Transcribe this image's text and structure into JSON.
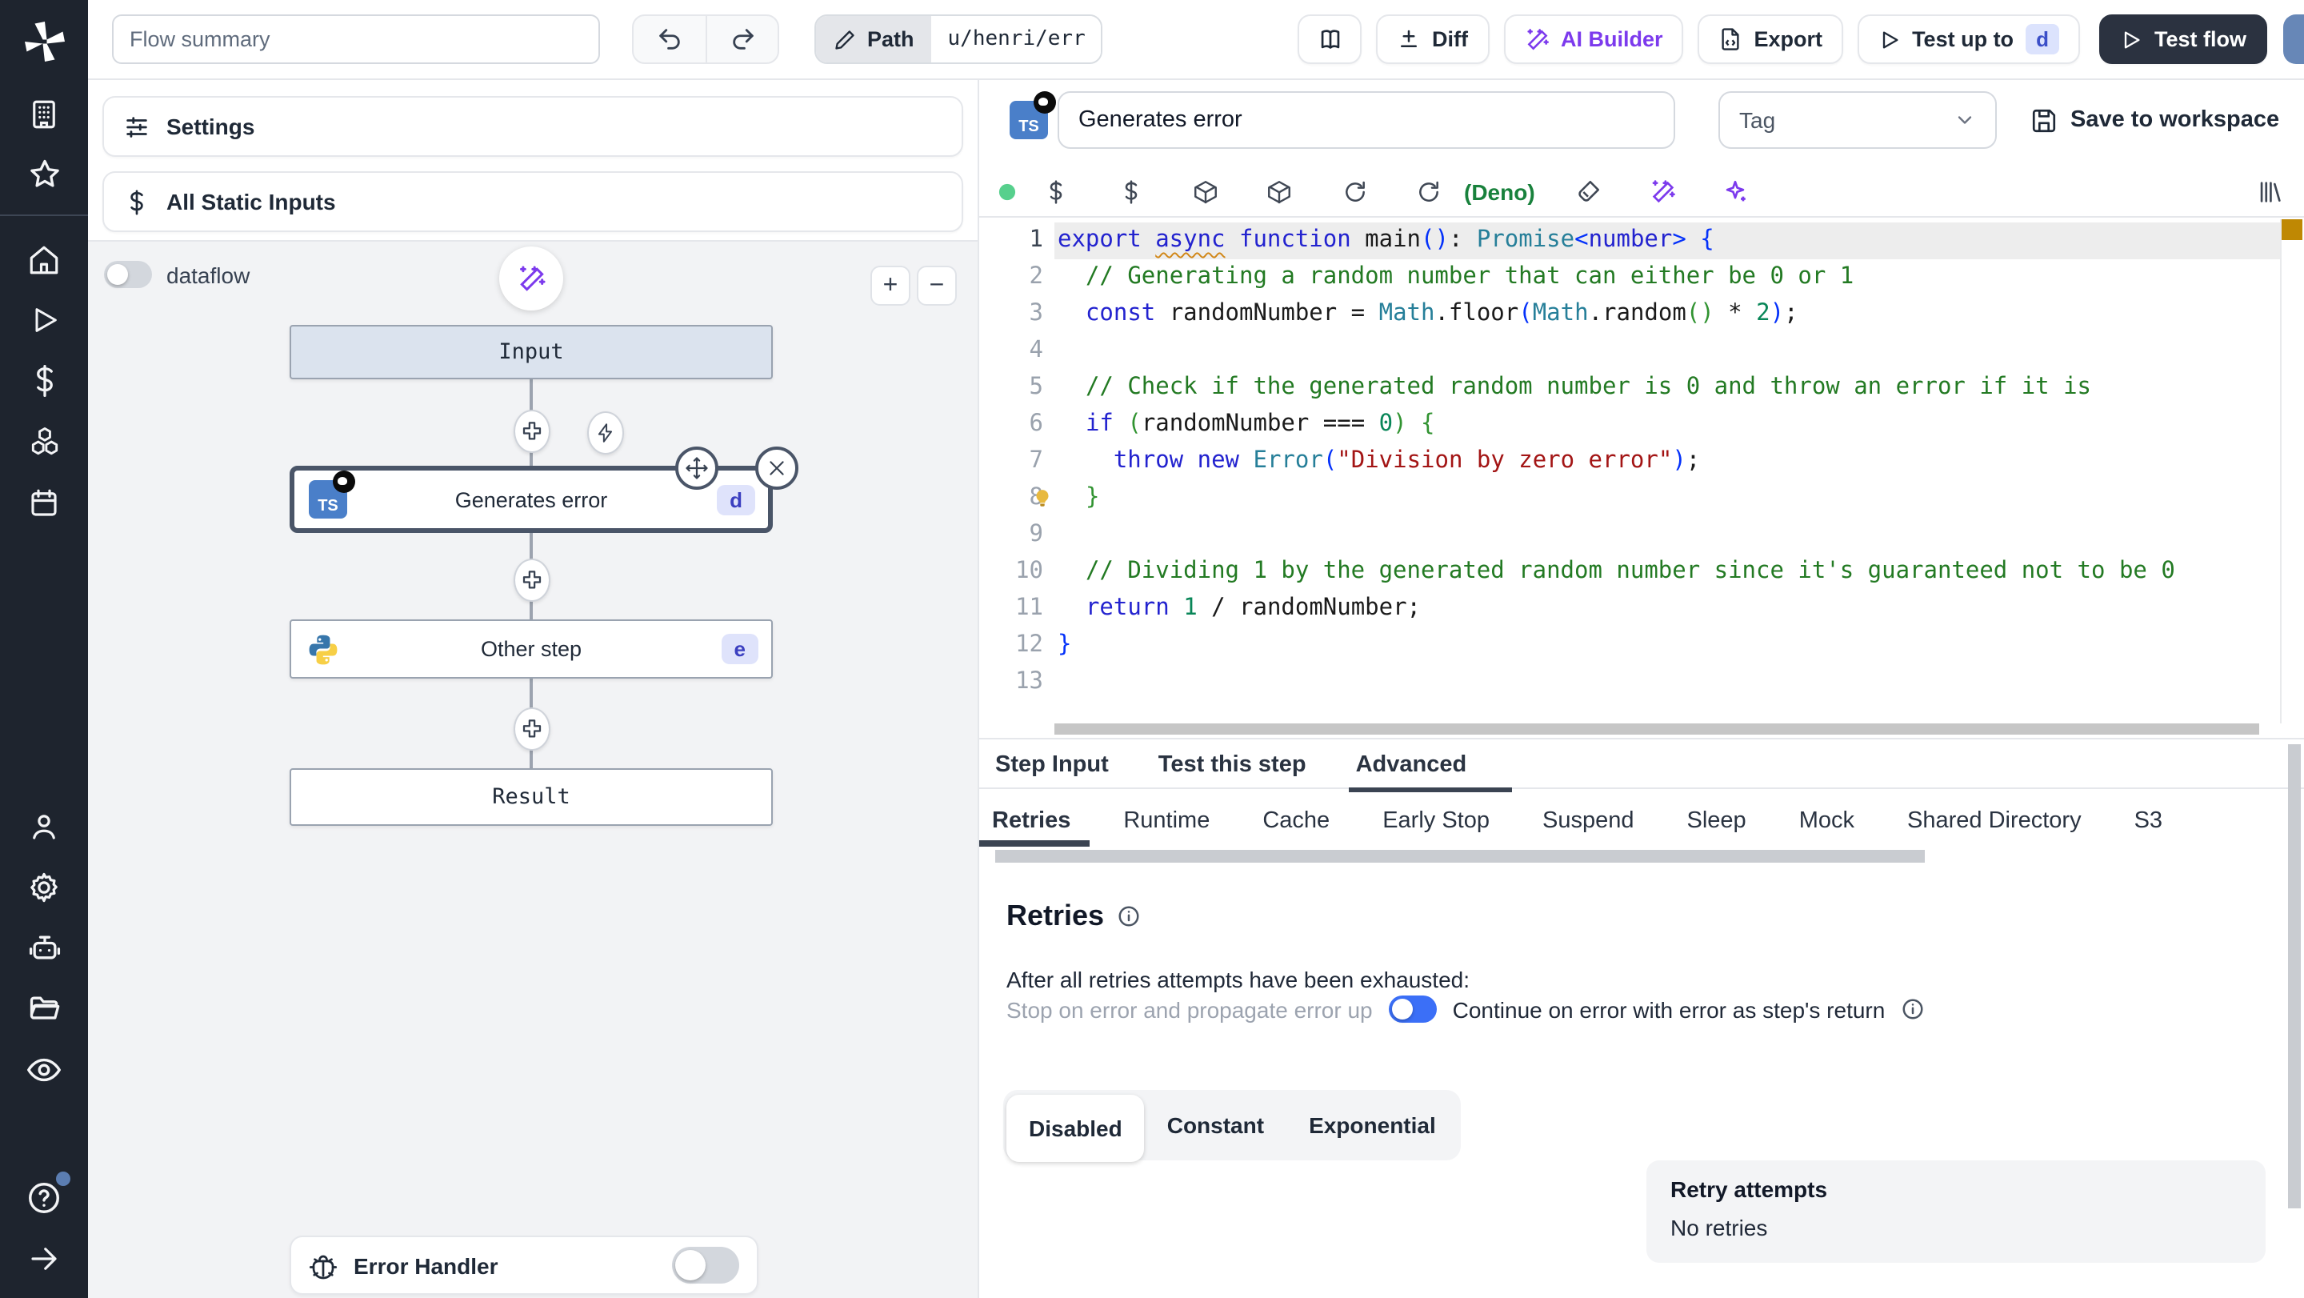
{
  "topbar": {
    "flow_summary_placeholder": "Flow summary",
    "path_label": "Path",
    "path_value": "u/henri/err",
    "diff_label": "Diff",
    "ai_builder_label": "AI Builder",
    "export_label": "Export",
    "test_up_to_label": "Test up to",
    "test_up_to_badge": "d",
    "test_flow_label": "Test flow"
  },
  "left_panel": {
    "settings_label": "Settings",
    "static_inputs_label": "All Static Inputs",
    "dataflow_label": "dataflow",
    "error_handler_label": "Error Handler",
    "nodes": {
      "input": "Input",
      "generates_error": "Generates error",
      "generates_error_badge": "d",
      "other_step": "Other step",
      "other_step_badge": "e",
      "result": "Result"
    }
  },
  "step": {
    "name": "Generates error",
    "tag_placeholder": "Tag",
    "save_label": "Save to workspace",
    "lang_note": "(Deno)"
  },
  "code": {
    "language": "typescript",
    "lines": [
      {
        "n": 1,
        "tokens": [
          {
            "t": "export ",
            "c": "kw"
          },
          {
            "t": "async",
            "c": "kw sq"
          },
          {
            "t": " ",
            "c": "pl"
          },
          {
            "t": "function",
            "c": "kw"
          },
          {
            "t": " main",
            "c": "pl"
          },
          {
            "t": "()",
            "c": "brb"
          },
          {
            "t": ": ",
            "c": "pl"
          },
          {
            "t": "Promise",
            "c": "ty"
          },
          {
            "t": "<",
            "c": "brb"
          },
          {
            "t": "number",
            "c": "kw"
          },
          {
            "t": ">",
            "c": "brb"
          },
          {
            "t": " ",
            "c": "pl"
          },
          {
            "t": "{",
            "c": "brb"
          }
        ]
      },
      {
        "n": 2,
        "tokens": [
          {
            "t": "  ",
            "c": "pl"
          },
          {
            "t": "// Generating a random number that can either be 0 or 1",
            "c": "cm"
          }
        ]
      },
      {
        "n": 3,
        "tokens": [
          {
            "t": "  ",
            "c": "pl"
          },
          {
            "t": "const",
            "c": "kw"
          },
          {
            "t": " randomNumber = ",
            "c": "pl"
          },
          {
            "t": "Math",
            "c": "ty"
          },
          {
            "t": ".floor",
            "c": "pl"
          },
          {
            "t": "(",
            "c": "brb"
          },
          {
            "t": "Math",
            "c": "ty"
          },
          {
            "t": ".random",
            "c": "pl"
          },
          {
            "t": "()",
            "c": "brg"
          },
          {
            "t": " * ",
            "c": "pl"
          },
          {
            "t": "2",
            "c": "nu"
          },
          {
            "t": ")",
            "c": "brb"
          },
          {
            "t": ";",
            "c": "pl"
          }
        ]
      },
      {
        "n": 4,
        "tokens": []
      },
      {
        "n": 5,
        "tokens": [
          {
            "t": "  ",
            "c": "pl"
          },
          {
            "t": "// Check if the generated random number is 0 and throw an error if it is",
            "c": "cm"
          }
        ]
      },
      {
        "n": 6,
        "tokens": [
          {
            "t": "  ",
            "c": "pl"
          },
          {
            "t": "if",
            "c": "kw"
          },
          {
            "t": " ",
            "c": "pl"
          },
          {
            "t": "(",
            "c": "brg"
          },
          {
            "t": "randomNumber === ",
            "c": "pl"
          },
          {
            "t": "0",
            "c": "nu"
          },
          {
            "t": ")",
            "c": "brg"
          },
          {
            "t": " ",
            "c": "pl"
          },
          {
            "t": "{",
            "c": "brg"
          }
        ]
      },
      {
        "n": 7,
        "tokens": [
          {
            "t": "    ",
            "c": "pl"
          },
          {
            "t": "throw",
            "c": "kw"
          },
          {
            "t": " ",
            "c": "pl"
          },
          {
            "t": "new",
            "c": "kw"
          },
          {
            "t": " ",
            "c": "pl"
          },
          {
            "t": "Error",
            "c": "ty"
          },
          {
            "t": "(",
            "c": "brb"
          },
          {
            "t": "\"Division by zero error\"",
            "c": "st"
          },
          {
            "t": ")",
            "c": "brb"
          },
          {
            "t": ";",
            "c": "pl"
          }
        ]
      },
      {
        "n": 8,
        "tokens": [
          {
            "t": "  ",
            "c": "pl"
          },
          {
            "t": "}",
            "c": "brg"
          }
        ]
      },
      {
        "n": 9,
        "tokens": []
      },
      {
        "n": 10,
        "tokens": [
          {
            "t": "  ",
            "c": "pl"
          },
          {
            "t": "// Dividing 1 by the generated random number since it's guaranteed not to be 0",
            "c": "cm"
          }
        ]
      },
      {
        "n": 11,
        "tokens": [
          {
            "t": "  ",
            "c": "pl"
          },
          {
            "t": "return",
            "c": "kw"
          },
          {
            "t": " ",
            "c": "pl"
          },
          {
            "t": "1",
            "c": "nu"
          },
          {
            "t": " / randomNumber;",
            "c": "pl"
          }
        ]
      },
      {
        "n": 12,
        "tokens": [
          {
            "t": "}",
            "c": "brb"
          }
        ]
      },
      {
        "n": 13,
        "tokens": []
      }
    ]
  },
  "tabs": {
    "main": [
      "Step Input",
      "Test this step",
      "Advanced"
    ],
    "active_main": "Advanced",
    "sub": [
      "Retries",
      "Runtime",
      "Cache",
      "Early Stop",
      "Suspend",
      "Sleep",
      "Mock",
      "Shared Directory",
      "S3"
    ],
    "active_sub": "Retries"
  },
  "retries": {
    "title": "Retries",
    "exhausted_label": "After all retries attempts have been exhausted:",
    "stop_option": "Stop on error and propagate error up",
    "continue_option": "Continue on error with error as step's return",
    "continue_enabled": true,
    "modes": [
      "Disabled",
      "Constant",
      "Exponential"
    ],
    "active_mode": "Disabled",
    "retry_attempts_label": "Retry attempts",
    "retry_attempts_value": "No retries"
  },
  "colors": {
    "sidebar_bg": "#1e242e",
    "accent_purple": "#7c3aed",
    "toggle_on_blue": "#3b6ff7",
    "badge_bg": "#dfe3fb",
    "badge_text": "#3b3fc0",
    "dark_button": "#2b3240",
    "input_node_bg": "#dbe3ee",
    "deno_green": "#18813c",
    "overview_marker": "#bf8803"
  }
}
